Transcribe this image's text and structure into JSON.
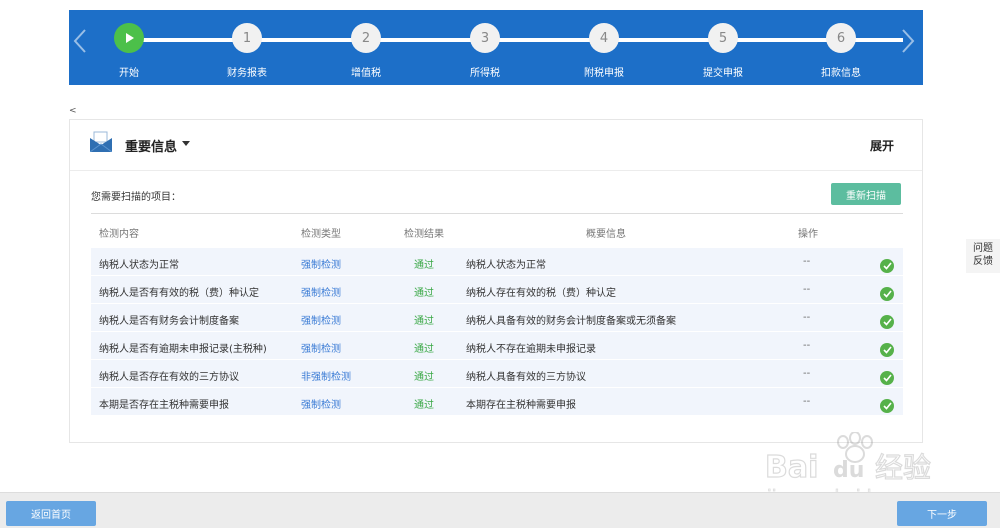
{
  "stepper": {
    "steps": [
      {
        "num": "",
        "label": "开始",
        "active": true
      },
      {
        "num": "1",
        "label": "财务报表"
      },
      {
        "num": "2",
        "label": "增值税"
      },
      {
        "num": "3",
        "label": "所得税"
      },
      {
        "num": "4",
        "label": "附税申报"
      },
      {
        "num": "5",
        "label": "提交申报"
      },
      {
        "num": "6",
        "label": "扣款信息"
      }
    ],
    "colors": {
      "bar": "#1d6fc8",
      "active": "#4cc04a"
    }
  },
  "misc": {
    "lt": "<"
  },
  "panel": {
    "title": "重要信息",
    "expand_label": "展开",
    "scan_text": "您需要扫描的项目：",
    "rescan_label": "重新扫描"
  },
  "table": {
    "headers": {
      "content": "检测内容",
      "type": "检测类型",
      "result": "检测结果",
      "summary": "概要信息",
      "op": "操作"
    },
    "rows": [
      {
        "content": "纳税人状态为正常",
        "type": "强制检测",
        "result": "通过",
        "summary": "纳税人状态为正常",
        "op": "--"
      },
      {
        "content": "纳税人是否有有效的税（费）种认定",
        "type": "强制检测",
        "result": "通过",
        "summary": "纳税人存在有效的税（费）种认定",
        "op": "--"
      },
      {
        "content": "纳税人是否有财务会计制度备案",
        "type": "强制检测",
        "result": "通过",
        "summary": "纳税人具备有效的财务会计制度备案或无须备案",
        "op": "--"
      },
      {
        "content": "纳税人是否有逾期未申报记录(主税种)",
        "type": "强制检测",
        "result": "通过",
        "summary": "纳税人不存在逾期未申报记录",
        "op": "--"
      },
      {
        "content": "纳税人是否存在有效的三方协议",
        "type": "非强制检测",
        "result": "通过",
        "summary": "纳税人具备有效的三方协议",
        "op": "--"
      },
      {
        "content": "本期是否存在主税种需要申报",
        "type": "强制检测",
        "result": "通过",
        "summary": "本期存在主税种需要申报",
        "op": "--"
      }
    ]
  },
  "feedback": {
    "line1": "问题",
    "line2": "反馈"
  },
  "footer": {
    "home_label": "返回首页",
    "next_label": "下一步"
  },
  "watermark": {
    "brand": "Bai",
    "brand2": "du",
    "cn": "经验",
    "url": "jingyan.baidu.com"
  }
}
